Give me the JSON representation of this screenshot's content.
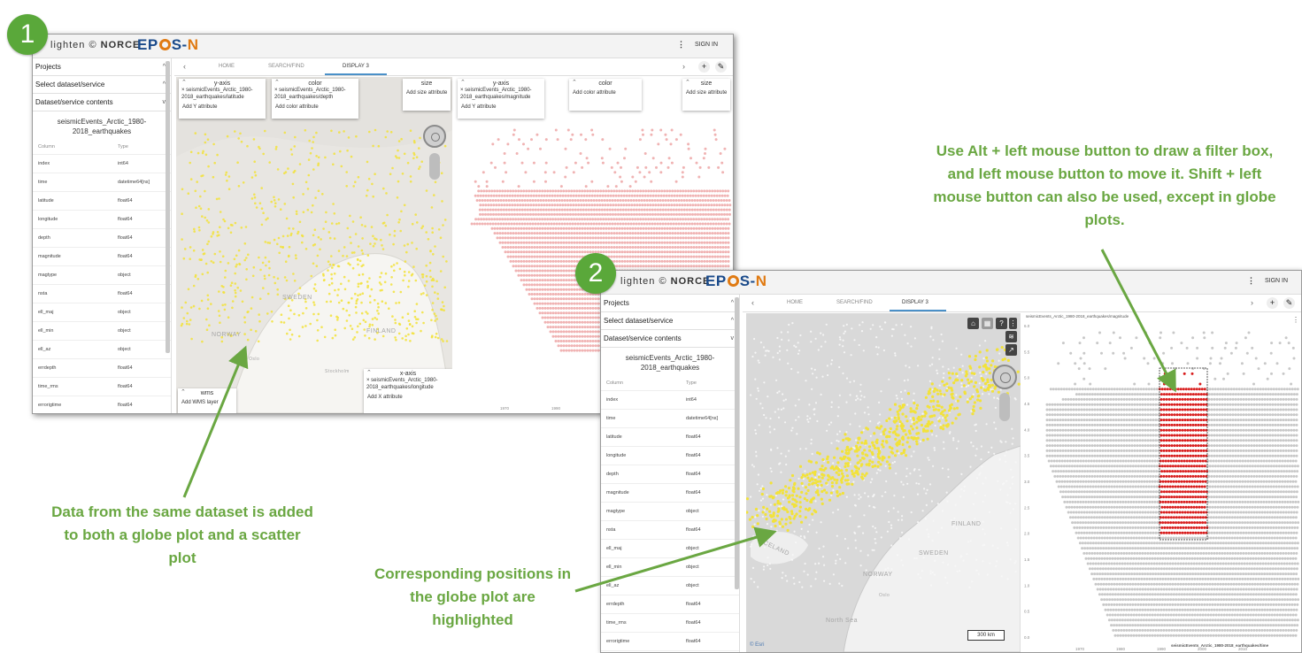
{
  "step1": {
    "badge": "1",
    "brand": {
      "prefix": "lighten",
      "name": "NORCE"
    },
    "epos": {
      "pre": "EP",
      "post": "S-",
      "n": "N",
      "sub": "EUROPEAN PLATE OBSERVING SYSTEM — NORWAY"
    },
    "kebab": "⋮",
    "signin": "SIGN IN",
    "sidebar": {
      "projects": "Projects",
      "select": "Select dataset/service",
      "contents": "Dataset/service contents",
      "dataset_name": "seismicEvents_Arctic_1980-2018_earthquakes",
      "col_header": [
        "Column",
        "Type"
      ],
      "columns": [
        [
          "index",
          "int64"
        ],
        [
          "time",
          "datetime64[ns]"
        ],
        [
          "latitude",
          "float64"
        ],
        [
          "longitude",
          "float64"
        ],
        [
          "depth",
          "float64"
        ],
        [
          "magnitude",
          "float64"
        ],
        [
          "magtype",
          "object"
        ],
        [
          "nsta",
          "float64"
        ],
        [
          "ell_maj",
          "object"
        ],
        [
          "ell_min",
          "object"
        ],
        [
          "ell_az",
          "object"
        ],
        [
          "errdepth",
          "float64"
        ],
        [
          "time_rms",
          "float64"
        ],
        [
          "errorigtime",
          "float64"
        ],
        [
          "strike",
          "float64"
        ]
      ]
    },
    "tabs": {
      "prev": "‹",
      "home": "HOME",
      "search": "SEARCH/FIND",
      "display": "DISPLAY 3",
      "next": "›",
      "add": "+",
      "edit": "✎"
    },
    "globe_cards": {
      "yaxis_title": "y-axis",
      "yaxis_value": "seismicEvents_Arctic_1980-2018_earthquakes/latitude",
      "yaxis_add": "Add Y attribute",
      "color_title": "color",
      "color_value": "seismicEvents_Arctic_1980-2018_earthquakes/depth",
      "color_add": "Add color attribute",
      "size_title": "size",
      "size_add": "Add size attribute",
      "wms_title": "wms",
      "wms_add": "Add WMS layer",
      "xaxis_title": "x-axis",
      "xaxis_value": "seismicEvents_Arctic_1980-2018_earthquakes/longitude",
      "xaxis_add": "Add X attribute"
    },
    "scatter_cards": {
      "yaxis_title": "y-axis",
      "yaxis_value": "seismicEvents_Arctic_1980-2018_earthquakes/magnitude",
      "yaxis_add": "Add Y attribute",
      "color_title": "color",
      "color_add": "Add color attribute",
      "size_title": "size",
      "size_add": "Add size attribute"
    },
    "map_labels": {
      "sweden": "SWEDEN",
      "norway": "NORWAY",
      "finland": "FINLAND",
      "oslo": "Oslo",
      "stockholm": "Stockholm"
    },
    "xticks": [
      "1970",
      "1990"
    ]
  },
  "step2": {
    "badge": "2",
    "brand": {
      "prefix": "lighten",
      "name": "NORCE"
    },
    "epos": {
      "pre": "EP",
      "post": "S-",
      "n": "N",
      "sub": "EUROPEAN PLATE OBSERVING SYSTEM — NORWAY"
    },
    "kebab": "⋮",
    "signin": "SIGN IN",
    "sidebar": {
      "projects": "Projects",
      "select": "Select dataset/service",
      "contents": "Dataset/service contents",
      "dataset_name": "seismicEvents_Arctic_1980-2018_earthquakes",
      "col_header": [
        "Column",
        "Type"
      ],
      "columns": [
        [
          "index",
          "int64"
        ],
        [
          "time",
          "datetime64[ns]"
        ],
        [
          "latitude",
          "float64"
        ],
        [
          "longitude",
          "float64"
        ],
        [
          "depth",
          "float64"
        ],
        [
          "magnitude",
          "float64"
        ],
        [
          "magtype",
          "object"
        ],
        [
          "nsta",
          "float64"
        ],
        [
          "ell_maj",
          "object"
        ],
        [
          "ell_min",
          "object"
        ],
        [
          "ell_az",
          "object"
        ],
        [
          "errdepth",
          "float64"
        ],
        [
          "time_rms",
          "float64"
        ],
        [
          "errorigtime",
          "float64"
        ],
        [
          "strike",
          "float64"
        ]
      ]
    },
    "tabs": {
      "prev": "‹",
      "home": "HOME",
      "search": "SEARCH/FIND",
      "display": "DISPLAY 3",
      "next": "›",
      "add": "+",
      "edit": "✎"
    },
    "map_labels": {
      "iceland": "ICELAND",
      "sweden": "SWEDEN",
      "norway": "NORWAY",
      "finland": "FINLAND",
      "oslo": "Oslo",
      "north_sea": "North Sea"
    },
    "scale": "300 km",
    "attribution": "© Esri",
    "plot_title": "seismicEvents_Arctic_1980-2018_earthquakes/magnitude",
    "plot_xtitle": "seismicEvents_Arctic_1980-2018_earthquakes/time",
    "yticks": [
      "6.0",
      "5.5",
      "5.0",
      "4.5",
      "4.0",
      "3.5",
      "3.0",
      "2.5",
      "2.0",
      "1.5",
      "1.0",
      "0.5",
      "0.0"
    ],
    "xticks": [
      "1970",
      "1980",
      "1990",
      "2000",
      "2010"
    ]
  },
  "callouts": {
    "filter": "Use Alt + left mouse button to draw a filter box, and left mouse button to move it. Shift + left mouse button can also be used, except in globe plots.",
    "same_dataset": "Data from the same dataset is added to both a globe plot and a scatter plot",
    "highlighted": "Corresponding positions in the globe plot are highlighted"
  },
  "colors": {
    "accent_green": "#6aa742",
    "badge_green": "#5aa83a",
    "yellow": "#f2e23a",
    "pink": "#f0b3b3",
    "red": "#d81e1e",
    "grey_points": "#c8c8c8"
  }
}
